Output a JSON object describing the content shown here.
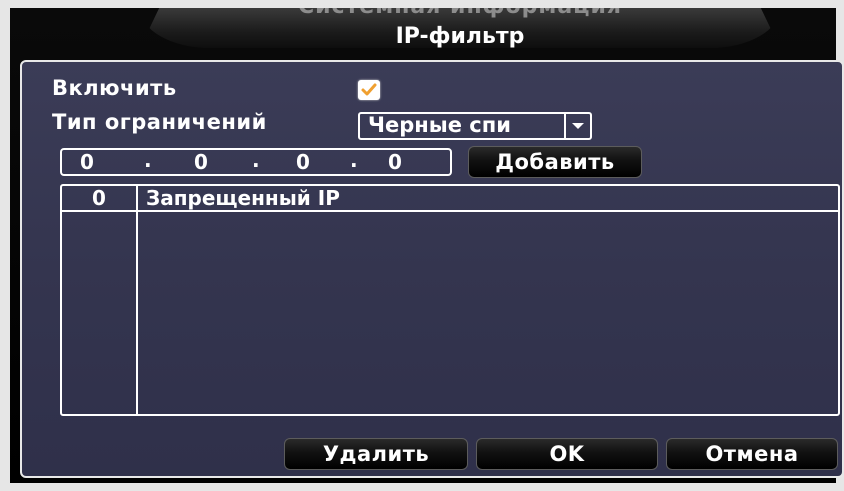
{
  "dialog": {
    "title_obscured": "Системная информация",
    "title": "IP-фильтр"
  },
  "enable": {
    "label": "Включить",
    "checked": true,
    "check_color": "#f0a030"
  },
  "restriction": {
    "label": "Тип ограничений",
    "selected": "Черные спи"
  },
  "ip_input": {
    "octets": [
      "0",
      "0",
      "0",
      "0"
    ],
    "separator": "."
  },
  "buttons": {
    "add": "Добавить",
    "delete": "Удалить",
    "ok": "OK",
    "cancel": "Отмена"
  },
  "table": {
    "count": "0",
    "column_header": "Запрещенный IP",
    "rows": []
  },
  "colors": {
    "panel_bg": "#36374f",
    "border": "#ffffff",
    "text": "#ffffff"
  }
}
